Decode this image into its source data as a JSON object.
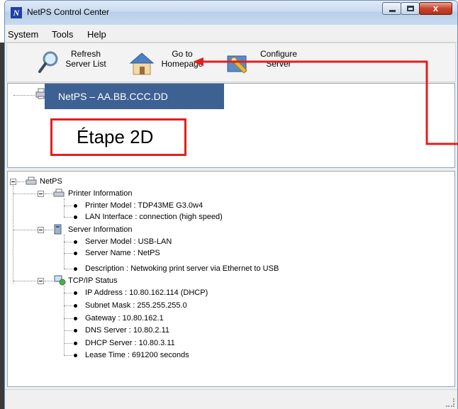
{
  "window": {
    "title": "NetPS Control Center",
    "app_icon_letter": "N"
  },
  "title_buttons": {
    "minimize": "minimize",
    "maximize": "maximize",
    "close": "x"
  },
  "menu": [
    {
      "label": "System"
    },
    {
      "label": "Tools"
    },
    {
      "label": "Help"
    }
  ],
  "toolbar": {
    "refresh": {
      "label": "Refresh\nServer List",
      "icon": "magnifier-icon"
    },
    "homepage": {
      "label": "Go to\nHomepage",
      "icon": "house-icon"
    },
    "configure": {
      "label": "Configure\nServer",
      "icon": "configure-icon"
    }
  },
  "server_list": {
    "selected": "NetPS – AA.BB.CCC.DD"
  },
  "callout": {
    "text": "Étape 2D",
    "color": "#e21f1f"
  },
  "tree": {
    "root": "NetPS",
    "groups": [
      {
        "label": "Printer Information",
        "items": [
          "Printer Model : TDP43ME G3.0w4",
          "LAN Interface : connection (high speed)"
        ]
      },
      {
        "label": "Server Information",
        "items": [
          "Server Model : USB-LAN",
          "Server Name : NetPS",
          "Description : Netwoking print server via Ethernet to USB"
        ]
      },
      {
        "label": "TCP/IP Status",
        "items": [
          "IP Address : 10.80.162.114 (DHCP)",
          "Subnet Mask : 255.255.255.0",
          "Gateway : 10.80.162.1",
          "DNS Server : 10.80.2.11",
          "DHCP Server : 10.80.3.11",
          "Lease Time : 691200 seconds"
        ]
      }
    ]
  },
  "colors": {
    "selection": "#3e6193",
    "arrow": "#e21f1f"
  }
}
